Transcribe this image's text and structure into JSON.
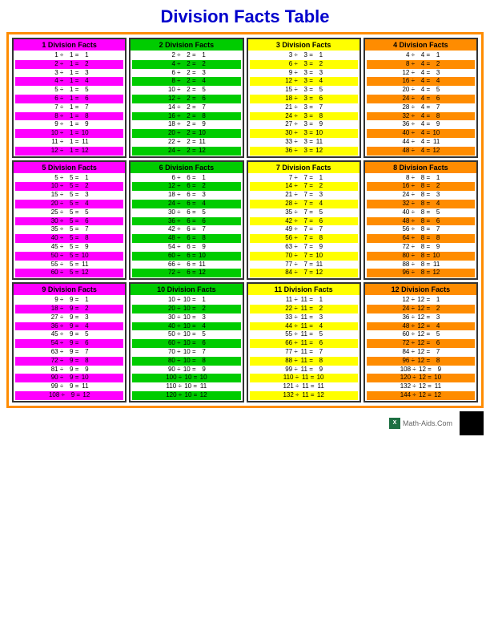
{
  "title": "Division Facts Table",
  "sections": [
    {
      "id": 1,
      "label": "1 Division Facts",
      "hdrClass": "hdr-1",
      "highlightClass": "row-highlight-1",
      "facts": [
        [
          1,
          1,
          1
        ],
        [
          2,
          1,
          2
        ],
        [
          3,
          1,
          3
        ],
        [
          4,
          1,
          4
        ],
        [
          5,
          1,
          5
        ],
        [
          6,
          1,
          6
        ],
        [
          7,
          1,
          7
        ],
        [
          8,
          1,
          8
        ],
        [
          9,
          1,
          9
        ],
        [
          10,
          1,
          10
        ],
        [
          11,
          1,
          11
        ],
        [
          12,
          1,
          12
        ]
      ]
    },
    {
      "id": 2,
      "label": "2 Division Facts",
      "hdrClass": "hdr-2",
      "highlightClass": "row-highlight-2",
      "facts": [
        [
          2,
          2,
          1
        ],
        [
          4,
          2,
          2
        ],
        [
          6,
          2,
          3
        ],
        [
          8,
          2,
          4
        ],
        [
          10,
          2,
          5
        ],
        [
          12,
          2,
          6
        ],
        [
          14,
          2,
          7
        ],
        [
          16,
          2,
          8
        ],
        [
          18,
          2,
          9
        ],
        [
          20,
          2,
          10
        ],
        [
          22,
          2,
          11
        ],
        [
          24,
          2,
          12
        ]
      ]
    },
    {
      "id": 3,
      "label": "3 Division Facts",
      "hdrClass": "hdr-3",
      "highlightClass": "row-highlight-3",
      "facts": [
        [
          3,
          3,
          1
        ],
        [
          6,
          3,
          2
        ],
        [
          9,
          3,
          3
        ],
        [
          12,
          3,
          4
        ],
        [
          15,
          3,
          5
        ],
        [
          18,
          3,
          6
        ],
        [
          21,
          3,
          7
        ],
        [
          24,
          3,
          8
        ],
        [
          27,
          3,
          9
        ],
        [
          30,
          3,
          10
        ],
        [
          33,
          3,
          11
        ],
        [
          36,
          3,
          12
        ]
      ]
    },
    {
      "id": 4,
      "label": "4 Division Facts",
      "hdrClass": "hdr-4",
      "highlightClass": "row-highlight-4",
      "facts": [
        [
          4,
          4,
          1
        ],
        [
          8,
          4,
          2
        ],
        [
          12,
          4,
          3
        ],
        [
          16,
          4,
          4
        ],
        [
          20,
          4,
          5
        ],
        [
          24,
          4,
          6
        ],
        [
          28,
          4,
          7
        ],
        [
          32,
          4,
          8
        ],
        [
          36,
          4,
          9
        ],
        [
          40,
          4,
          10
        ],
        [
          44,
          4,
          11
        ],
        [
          48,
          4,
          12
        ]
      ]
    },
    {
      "id": 5,
      "label": "5 Division Facts",
      "hdrClass": "hdr-5",
      "highlightClass": "row-highlight-5",
      "facts": [
        [
          5,
          5,
          1
        ],
        [
          10,
          5,
          2
        ],
        [
          15,
          5,
          3
        ],
        [
          20,
          5,
          4
        ],
        [
          25,
          5,
          5
        ],
        [
          30,
          5,
          6
        ],
        [
          35,
          5,
          7
        ],
        [
          40,
          5,
          8
        ],
        [
          45,
          5,
          9
        ],
        [
          50,
          5,
          10
        ],
        [
          55,
          5,
          11
        ],
        [
          60,
          5,
          12
        ]
      ]
    },
    {
      "id": 6,
      "label": "6 Division Facts",
      "hdrClass": "hdr-6",
      "highlightClass": "row-highlight-6",
      "facts": [
        [
          6,
          6,
          1
        ],
        [
          12,
          6,
          2
        ],
        [
          18,
          6,
          3
        ],
        [
          24,
          6,
          4
        ],
        [
          30,
          6,
          5
        ],
        [
          36,
          6,
          6
        ],
        [
          42,
          6,
          7
        ],
        [
          48,
          6,
          8
        ],
        [
          54,
          6,
          9
        ],
        [
          60,
          6,
          10
        ],
        [
          66,
          6,
          11
        ],
        [
          72,
          6,
          12
        ]
      ]
    },
    {
      "id": 7,
      "label": "7 Division Facts",
      "hdrClass": "hdr-7",
      "highlightClass": "row-highlight-7",
      "facts": [
        [
          7,
          7,
          1
        ],
        [
          14,
          7,
          2
        ],
        [
          21,
          7,
          3
        ],
        [
          28,
          7,
          4
        ],
        [
          35,
          7,
          5
        ],
        [
          42,
          7,
          6
        ],
        [
          49,
          7,
          7
        ],
        [
          56,
          7,
          8
        ],
        [
          63,
          7,
          9
        ],
        [
          70,
          7,
          10
        ],
        [
          77,
          7,
          11
        ],
        [
          84,
          7,
          12
        ]
      ]
    },
    {
      "id": 8,
      "label": "8 Division Facts",
      "hdrClass": "hdr-8",
      "highlightClass": "row-highlight-8",
      "facts": [
        [
          8,
          8,
          1
        ],
        [
          16,
          8,
          2
        ],
        [
          24,
          8,
          3
        ],
        [
          32,
          8,
          4
        ],
        [
          40,
          8,
          5
        ],
        [
          48,
          8,
          6
        ],
        [
          56,
          8,
          7
        ],
        [
          64,
          8,
          8
        ],
        [
          72,
          8,
          9
        ],
        [
          80,
          8,
          10
        ],
        [
          88,
          8,
          11
        ],
        [
          96,
          8,
          12
        ]
      ]
    },
    {
      "id": 9,
      "label": "9 Division Facts",
      "hdrClass": "hdr-9",
      "highlightClass": "row-highlight-9",
      "facts": [
        [
          9,
          9,
          1
        ],
        [
          18,
          9,
          2
        ],
        [
          27,
          9,
          3
        ],
        [
          36,
          9,
          4
        ],
        [
          45,
          9,
          5
        ],
        [
          54,
          9,
          6
        ],
        [
          63,
          9,
          7
        ],
        [
          72,
          9,
          8
        ],
        [
          81,
          9,
          9
        ],
        [
          90,
          9,
          10
        ],
        [
          99,
          9,
          11
        ],
        [
          108,
          9,
          12
        ]
      ]
    },
    {
      "id": 10,
      "label": "10 Division Facts",
      "hdrClass": "hdr-10",
      "highlightClass": "row-highlight-10",
      "facts": [
        [
          10,
          10,
          1
        ],
        [
          20,
          10,
          2
        ],
        [
          30,
          10,
          3
        ],
        [
          40,
          10,
          4
        ],
        [
          50,
          10,
          5
        ],
        [
          60,
          10,
          6
        ],
        [
          70,
          10,
          7
        ],
        [
          80,
          10,
          8
        ],
        [
          90,
          10,
          9
        ],
        [
          100,
          10,
          10
        ],
        [
          110,
          10,
          11
        ],
        [
          120,
          10,
          12
        ]
      ]
    },
    {
      "id": 11,
      "label": "11 Division Facts",
      "hdrClass": "hdr-11",
      "highlightClass": "row-highlight-11",
      "facts": [
        [
          11,
          11,
          1
        ],
        [
          22,
          11,
          2
        ],
        [
          33,
          11,
          3
        ],
        [
          44,
          11,
          4
        ],
        [
          55,
          11,
          5
        ],
        [
          66,
          11,
          6
        ],
        [
          77,
          11,
          7
        ],
        [
          88,
          11,
          8
        ],
        [
          99,
          11,
          9
        ],
        [
          110,
          11,
          10
        ],
        [
          121,
          11,
          11
        ],
        [
          132,
          11,
          12
        ]
      ]
    },
    {
      "id": 12,
      "label": "12 Division Facts",
      "hdrClass": "hdr-12",
      "highlightClass": "row-highlight-12",
      "facts": [
        [
          12,
          12,
          1
        ],
        [
          24,
          12,
          2
        ],
        [
          36,
          12,
          3
        ],
        [
          48,
          12,
          4
        ],
        [
          60,
          12,
          5
        ],
        [
          72,
          12,
          6
        ],
        [
          84,
          12,
          7
        ],
        [
          96,
          12,
          8
        ],
        [
          108,
          12,
          9
        ],
        [
          120,
          12,
          10
        ],
        [
          132,
          12,
          11
        ],
        [
          144,
          12,
          12
        ]
      ]
    }
  ],
  "footer": {
    "site": "Math-Aids.Com"
  }
}
